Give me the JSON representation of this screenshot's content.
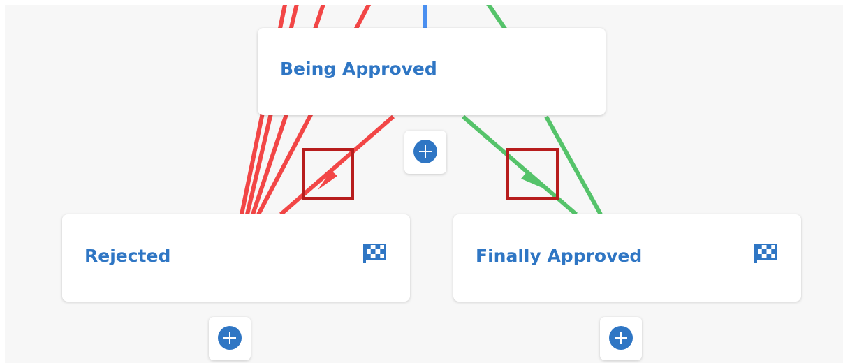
{
  "states": {
    "being_approved": {
      "title": "Being Approved"
    },
    "rejected": {
      "title": "Rejected",
      "icon": "checkered-flag-icon"
    },
    "finally_approved": {
      "title": "Finally Approved",
      "icon": "checkered-flag-icon"
    }
  },
  "add_buttons": [
    {
      "icon": "plus-circle-icon"
    },
    {
      "icon": "plus-circle-icon"
    },
    {
      "icon": "plus-circle-icon"
    }
  ],
  "colors": {
    "reject_transition": "#f24646",
    "approve_transition": "#55c36a",
    "incoming_transition": "#4a8ff0",
    "title_text": "#2f76c4",
    "highlight": "#b71d1d",
    "canvas_background": "#f7f7f7"
  }
}
